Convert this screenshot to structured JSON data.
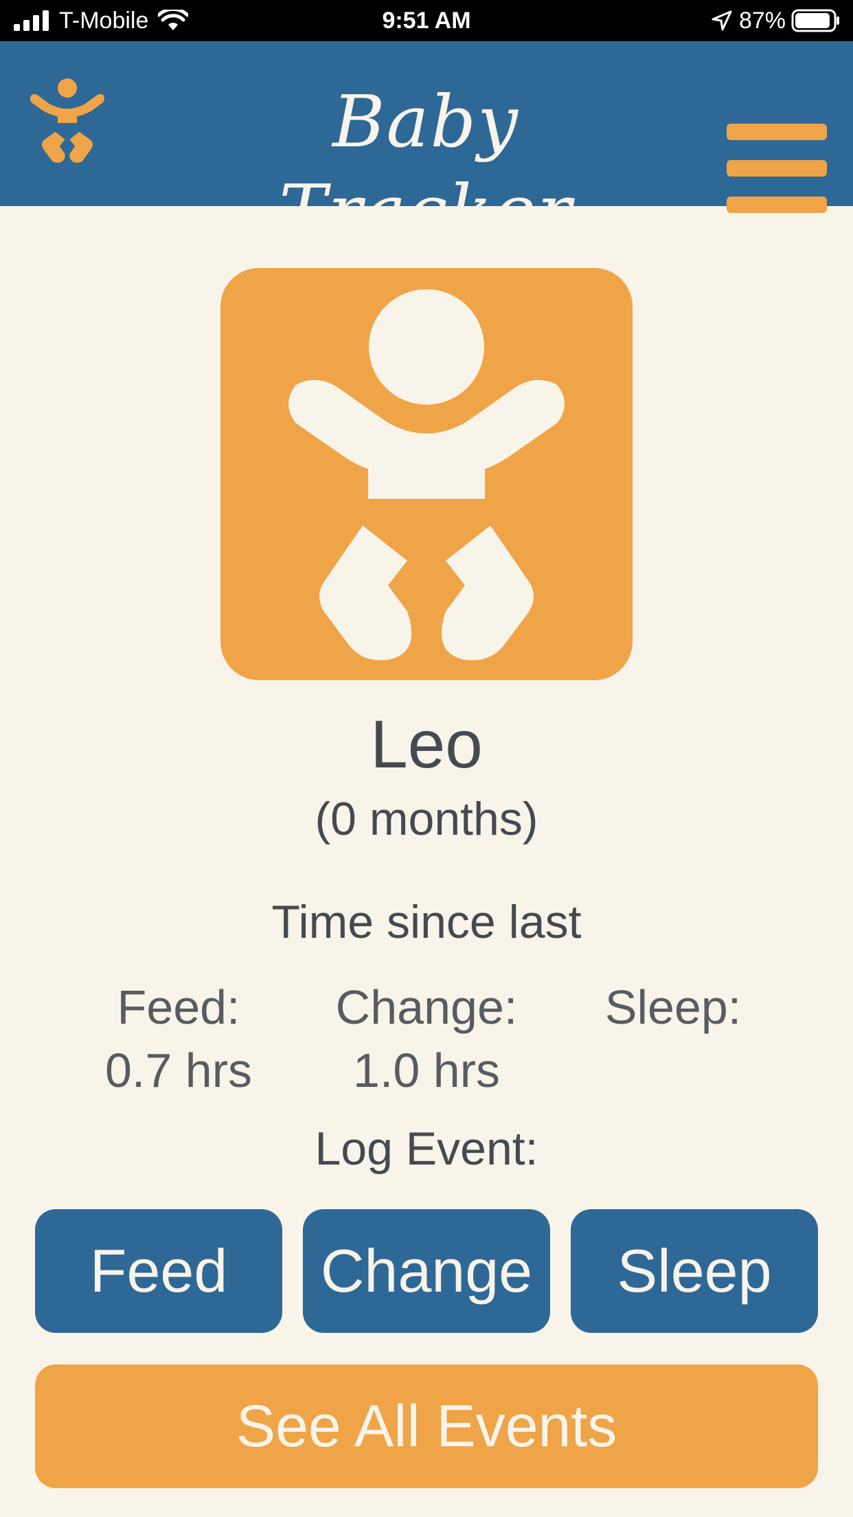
{
  "status_bar": {
    "carrier": "T-Mobile",
    "time": "9:51 AM",
    "battery": "87%"
  },
  "header": {
    "title": "Baby Tracker",
    "logo_icon": "baby-icon",
    "menu_icon": "hamburger-menu-icon"
  },
  "profile": {
    "avatar_icon": "baby-icon",
    "name": "Leo",
    "age": "(0 months)"
  },
  "time_since": {
    "heading": "Time since last",
    "items": [
      {
        "label": "Feed:",
        "value": "0.7 hrs"
      },
      {
        "label": "Change:",
        "value": "1.0 hrs"
      },
      {
        "label": "Sleep:",
        "value": ""
      }
    ]
  },
  "log_event": {
    "heading": "Log Event:",
    "buttons": [
      "Feed",
      "Change",
      "Sleep"
    ]
  },
  "see_all_label": "See All Events",
  "colors": {
    "primary_blue": "#2e6896",
    "accent_orange": "#efa448",
    "background": "#f8f4ea",
    "text": "#444a4f"
  }
}
